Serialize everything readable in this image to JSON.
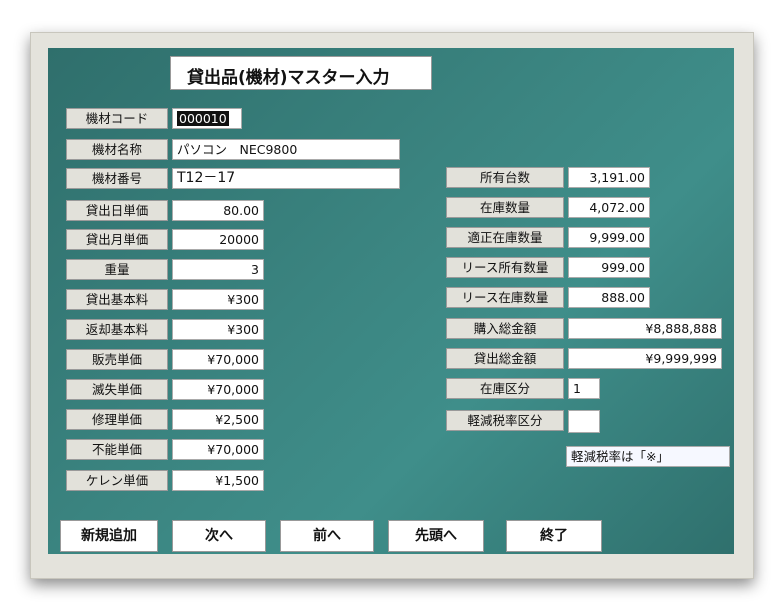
{
  "title": "貸出品(機材)マスター入力",
  "left_fields": [
    {
      "label": "機材コード",
      "value": "000010"
    },
    {
      "label": "機材名称",
      "value": "パソコン　NEC9800"
    },
    {
      "label": "機材番号",
      "value": "T12－17"
    },
    {
      "label": "貸出日単価",
      "value": "80.00"
    },
    {
      "label": "貸出月単価",
      "value": "20000"
    },
    {
      "label": "重量",
      "value": "3"
    },
    {
      "label": "貸出基本料",
      "value": "¥300"
    },
    {
      "label": "返却基本料",
      "value": "¥300"
    },
    {
      "label": "販売単価",
      "value": "¥70,000"
    },
    {
      "label": "滅失単価",
      "value": "¥70,000"
    },
    {
      "label": "修理単価",
      "value": "¥2,500"
    },
    {
      "label": "不能単価",
      "value": "¥70,000"
    },
    {
      "label": "ケレン単価",
      "value": "¥1,500"
    }
  ],
  "right_fields": [
    {
      "label": "所有台数",
      "value": "3,191.00"
    },
    {
      "label": "在庫数量",
      "value": "4,072.00"
    },
    {
      "label": "適正在庫数量",
      "value": "9,999.00"
    },
    {
      "label": "リース所有数量",
      "value": "999.00"
    },
    {
      "label": "リース在庫数量",
      "value": "888.00"
    },
    {
      "label": "購入総金額",
      "value": "¥8,888,888"
    },
    {
      "label": "貸出総金額",
      "value": "¥9,999,999"
    },
    {
      "label": "在庫区分",
      "value": "1"
    },
    {
      "label": "軽減税率区分",
      "value": ""
    }
  ],
  "note": "軽減税率は「※」",
  "buttons": {
    "new": "新規追加",
    "next": "次へ",
    "prev": "前へ",
    "first": "先頭へ",
    "end": "終了"
  }
}
